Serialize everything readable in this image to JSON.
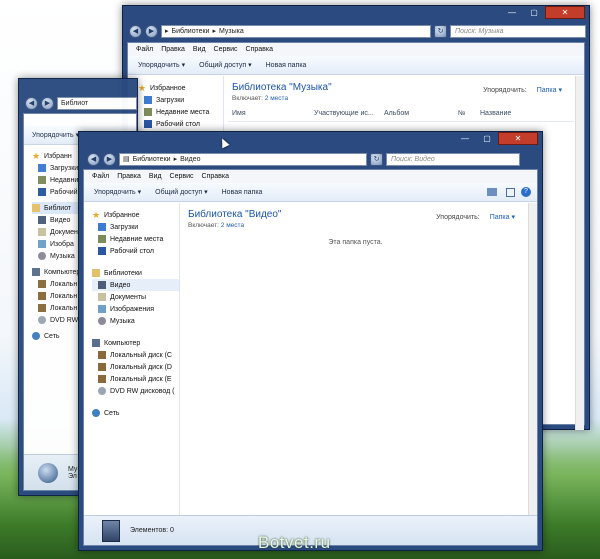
{
  "music_window": {
    "address": [
      "Библиотеки",
      "Музыка"
    ],
    "search_placeholder": "Поиск: Музыка",
    "menu": [
      "Файл",
      "Правка",
      "Вид",
      "Сервис",
      "Справка"
    ],
    "commands": [
      "Упорядочить ▾",
      "Общий доступ ▾",
      "Новая папка"
    ],
    "favorites": [
      "Избранное",
      "Загрузки",
      "Недавние места",
      "Рабочий стол"
    ],
    "title": "Библиотека \"Музыка\"",
    "includes_label": "Включает:",
    "includes_link": "2 места",
    "arrange_label": "Упорядочить:",
    "arrange_value": "Папка ▾",
    "columns": [
      "Имя",
      "Участвующие ис...",
      "Альбом",
      "№",
      "Название"
    ]
  },
  "back_window": {
    "address": "Библиот",
    "command": "Упорядочить ▾",
    "nav": [
      "Избранн",
      "Загрузки",
      "Недавни",
      "Рабочий",
      "Библиот",
      "Видео",
      "Докумен",
      "Изобра",
      "Музыка",
      "Компьютер",
      "Локальн",
      "Локальн",
      "Локальн",
      "DVD RW",
      "Сеть"
    ],
    "status_text": "Му",
    "status_text2": "Эл"
  },
  "video_window": {
    "address": [
      "Библиотеки",
      "Видео"
    ],
    "search_placeholder": "Поиск: Видео",
    "menu": [
      "Файл",
      "Правка",
      "Вид",
      "Сервис",
      "Справка"
    ],
    "commands": [
      "Упорядочить ▾",
      "Общий доступ ▾",
      "Новая папка"
    ],
    "nav": {
      "favorites": [
        "Избранное",
        "Загрузки",
        "Недавние места",
        "Рабочий стол"
      ],
      "libraries": [
        "Библиотеки",
        "Видео",
        "Документы",
        "Изображения",
        "Музыка"
      ],
      "computer": [
        "Компьютер",
        "Локальный диск (C",
        "Локальный диск (D",
        "Локальный диск (E",
        "DVD RW дисковод ("
      ],
      "network": "Сеть"
    },
    "title": "Библиотека \"Видео\"",
    "includes_label": "Включает:",
    "includes_link": "2 места",
    "arrange_label": "Упорядочить:",
    "arrange_value": "Папка ▾",
    "empty_message": "Эта папка пуста.",
    "status": "Элементов: 0"
  },
  "watermark": "Botvet.ru",
  "colors": {
    "accent_link": "#1d5fb9",
    "title_blue": "#1a55a8",
    "drag_border": "#2b3ff0"
  }
}
